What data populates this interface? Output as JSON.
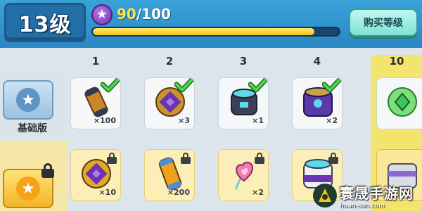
{
  "header": {
    "level_text": "13级",
    "xp_current": "90",
    "xp_max": "/100",
    "xp_progress": 0.9,
    "buy_level_label": "购买等级"
  },
  "columns": [
    "1",
    "2",
    "3",
    "4",
    "10"
  ],
  "rows": {
    "basic_label": "基础版"
  },
  "free_row": [
    {
      "icon": "canister-icon",
      "qty": "×100",
      "claimed": true
    },
    {
      "icon": "purple-medal-icon",
      "qty": "×3",
      "claimed": true
    },
    {
      "icon": "cyan-capsule-icon",
      "qty": "×1",
      "claimed": true
    },
    {
      "icon": "purple-chest-icon",
      "qty": "×2",
      "claimed": true
    },
    {
      "icon": "green-gem-icon",
      "qty": "",
      "claimed": false
    }
  ],
  "paid_row": [
    {
      "icon": "purple-medal-icon",
      "qty": "×10",
      "locked": true
    },
    {
      "icon": "canister-icon",
      "qty": "×200",
      "locked": true
    },
    {
      "icon": "heart-lollipop-icon",
      "qty": "×2",
      "locked": true
    },
    {
      "icon": "purple-chest-icon",
      "qty": "",
      "locked": true
    },
    {
      "icon": "gray-chest-icon",
      "qty": "",
      "locked": false
    }
  ],
  "watermark": {
    "name": "寰晟手游网",
    "url": "huan-sun.com"
  },
  "colors": {
    "header_blue": "#2a86c4",
    "xp_fill": "#f4c21a",
    "check_green": "#3cc83c",
    "premium_gold": "#f2b628"
  }
}
